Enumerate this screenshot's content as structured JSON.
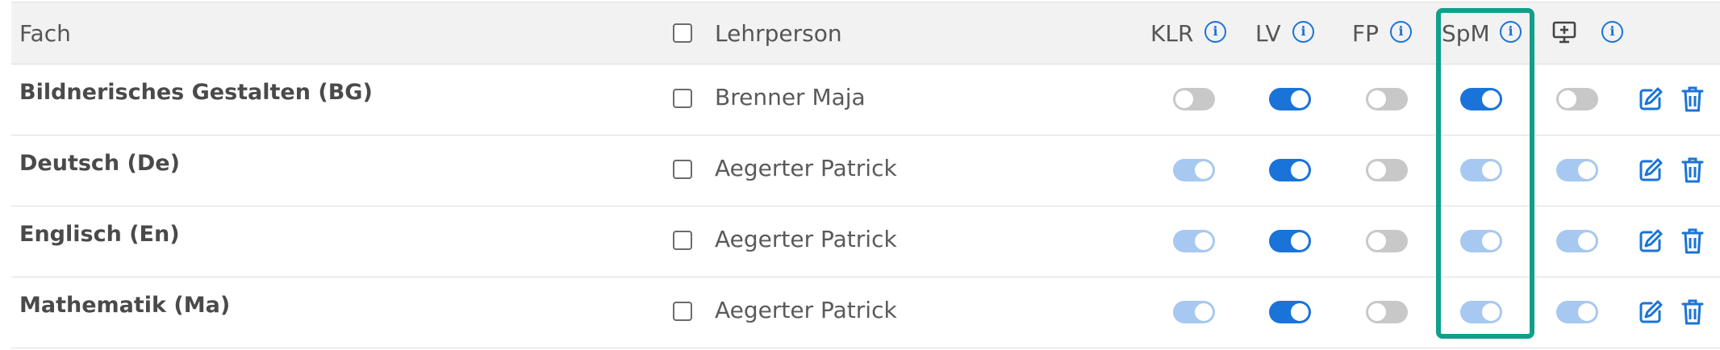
{
  "header": {
    "subject": "Fach",
    "teacher": "Lehrperson",
    "col_klr": "KLR",
    "col_lv": "LV",
    "col_fp": "FP",
    "col_spm": "SpM",
    "col_screen_icon": "monitor-plus-icon",
    "info_icon": "info-icon"
  },
  "rows": [
    {
      "subject": "Bildnerisches Gestalten (BG)",
      "teacher": "Brenner Maja",
      "klr": "off",
      "lv": "on",
      "fp": "off",
      "spm": "on",
      "screen": "off"
    },
    {
      "subject": "Deutsch (De)",
      "teacher": "Aegerter Patrick",
      "klr": "on-disabled",
      "lv": "on",
      "fp": "off",
      "spm": "on-disabled",
      "screen": "on-disabled"
    },
    {
      "subject": "Englisch (En)",
      "teacher": "Aegerter Patrick",
      "klr": "on-disabled",
      "lv": "on",
      "fp": "off",
      "spm": "on-disabled",
      "screen": "on-disabled"
    },
    {
      "subject": "Mathematik (Ma)",
      "teacher": "Aegerter Patrick",
      "klr": "on-disabled",
      "lv": "on",
      "fp": "off",
      "spm": "on-disabled",
      "screen": "on-disabled"
    }
  ],
  "colors": {
    "accent": "#1a73d8",
    "toggle_off": "#c8c8c8",
    "toggle_disabled_on": "#a7c8f0",
    "highlight": "#10a08a"
  }
}
